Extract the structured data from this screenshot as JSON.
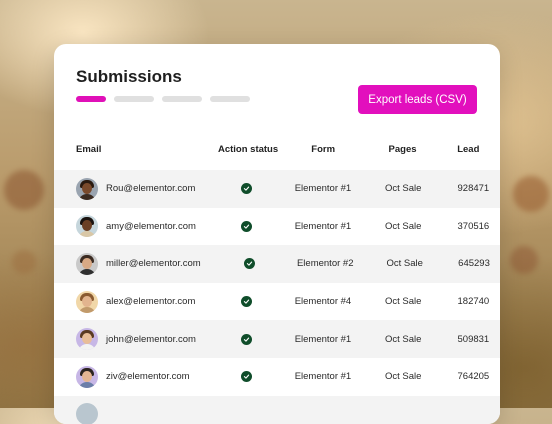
{
  "title": "Submissions",
  "export_button": "Export leads (CSV)",
  "progress": {
    "steps": 4,
    "active": 1
  },
  "columns": [
    "Email",
    "Action status",
    "Form",
    "Pages",
    "Lead"
  ],
  "rows": [
    {
      "email": "Rou@elementor.com",
      "form": "Elementor #1",
      "pages": "Oct Sale",
      "lead": "928471",
      "avatar": {
        "bg": "#9aa4b0",
        "skin": "#7a4a2c",
        "hair": "#2a1a10",
        "shirt": "#3b2a20"
      }
    },
    {
      "email": "amy@elementor.com",
      "form": "Elementor #1",
      "pages": "Oct Sale",
      "lead": "370516",
      "avatar": {
        "bg": "#c6d6dc",
        "skin": "#6b3f24",
        "hair": "#1a1310",
        "shirt": "#d9c7a6"
      }
    },
    {
      "email": "miller@elementor.com",
      "form": "Elementor #2",
      "pages": "Oct Sale",
      "lead": "645293",
      "avatar": {
        "bg": "#c9c9c9",
        "skin": "#d8a985",
        "hair": "#3b2b22",
        "shirt": "#2f2f2f"
      }
    },
    {
      "email": "alex@elementor.com",
      "form": "Elementor #4",
      "pages": "Oct Sale",
      "lead": "182740",
      "avatar": {
        "bg": "#f1d7a8",
        "skin": "#e2b48e",
        "hair": "#8a5a30",
        "shirt": "#c19a6b"
      }
    },
    {
      "email": "john@elementor.com",
      "form": "Elementor #1",
      "pages": "Oct Sale",
      "lead": "509831",
      "avatar": {
        "bg": "#c7b7e6",
        "skin": "#e8bd98",
        "hair": "#5a3a22",
        "shirt": "#f2f2f2"
      }
    },
    {
      "email": "ziv@elementor.com",
      "form": "Elementor #1",
      "pages": "Oct Sale",
      "lead": "764205",
      "avatar": {
        "bg": "#c7b7e6",
        "skin": "#e4b592",
        "hair": "#2c241f",
        "shirt": "#6b7ea8"
      }
    }
  ],
  "colors": {
    "accent": "#e20fbd",
    "check": "#0f4d2a"
  }
}
